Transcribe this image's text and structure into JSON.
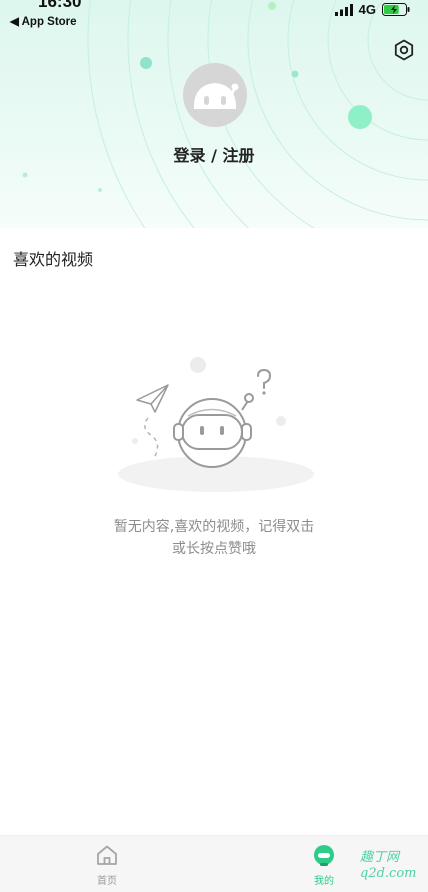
{
  "status": {
    "time": "16:30",
    "back_app": "◀ App Store",
    "network": "4G",
    "battery_level": 0.7
  },
  "header": {
    "login_label": "登录 / 注册"
  },
  "favorites": {
    "title": "喜欢的视频",
    "empty_line1": "暂无内容,喜欢的视频，记得双击",
    "empty_line2": "或长按点赞哦"
  },
  "tabs": [
    {
      "label": "首页",
      "icon": "home-icon",
      "active": false
    },
    {
      "label": "我的",
      "icon": "robot-face-icon",
      "active": true
    }
  ],
  "watermark": {
    "line1": "趣丁网",
    "line2": "q2d.com"
  },
  "colors": {
    "accent": "#2ecc8a",
    "header_bg": "#e4f8f0",
    "muted_text": "#8c8c8c"
  }
}
